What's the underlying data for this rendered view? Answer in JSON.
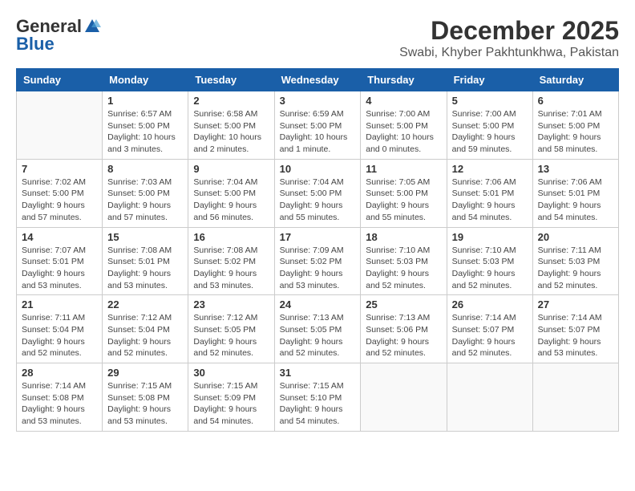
{
  "header": {
    "logo_general": "General",
    "logo_blue": "Blue",
    "month_year": "December 2025",
    "location": "Swabi, Khyber Pakhtunkhwa, Pakistan"
  },
  "weekdays": [
    "Sunday",
    "Monday",
    "Tuesday",
    "Wednesday",
    "Thursday",
    "Friday",
    "Saturday"
  ],
  "weeks": [
    [
      {
        "day": "",
        "info": ""
      },
      {
        "day": "1",
        "info": "Sunrise: 6:57 AM\nSunset: 5:00 PM\nDaylight: 10 hours\nand 3 minutes."
      },
      {
        "day": "2",
        "info": "Sunrise: 6:58 AM\nSunset: 5:00 PM\nDaylight: 10 hours\nand 2 minutes."
      },
      {
        "day": "3",
        "info": "Sunrise: 6:59 AM\nSunset: 5:00 PM\nDaylight: 10 hours\nand 1 minute."
      },
      {
        "day": "4",
        "info": "Sunrise: 7:00 AM\nSunset: 5:00 PM\nDaylight: 10 hours\nand 0 minutes."
      },
      {
        "day": "5",
        "info": "Sunrise: 7:00 AM\nSunset: 5:00 PM\nDaylight: 9 hours\nand 59 minutes."
      },
      {
        "day": "6",
        "info": "Sunrise: 7:01 AM\nSunset: 5:00 PM\nDaylight: 9 hours\nand 58 minutes."
      }
    ],
    [
      {
        "day": "7",
        "info": "Sunrise: 7:02 AM\nSunset: 5:00 PM\nDaylight: 9 hours\nand 57 minutes."
      },
      {
        "day": "8",
        "info": "Sunrise: 7:03 AM\nSunset: 5:00 PM\nDaylight: 9 hours\nand 57 minutes."
      },
      {
        "day": "9",
        "info": "Sunrise: 7:04 AM\nSunset: 5:00 PM\nDaylight: 9 hours\nand 56 minutes."
      },
      {
        "day": "10",
        "info": "Sunrise: 7:04 AM\nSunset: 5:00 PM\nDaylight: 9 hours\nand 55 minutes."
      },
      {
        "day": "11",
        "info": "Sunrise: 7:05 AM\nSunset: 5:00 PM\nDaylight: 9 hours\nand 55 minutes."
      },
      {
        "day": "12",
        "info": "Sunrise: 7:06 AM\nSunset: 5:01 PM\nDaylight: 9 hours\nand 54 minutes."
      },
      {
        "day": "13",
        "info": "Sunrise: 7:06 AM\nSunset: 5:01 PM\nDaylight: 9 hours\nand 54 minutes."
      }
    ],
    [
      {
        "day": "14",
        "info": "Sunrise: 7:07 AM\nSunset: 5:01 PM\nDaylight: 9 hours\nand 53 minutes."
      },
      {
        "day": "15",
        "info": "Sunrise: 7:08 AM\nSunset: 5:01 PM\nDaylight: 9 hours\nand 53 minutes."
      },
      {
        "day": "16",
        "info": "Sunrise: 7:08 AM\nSunset: 5:02 PM\nDaylight: 9 hours\nand 53 minutes."
      },
      {
        "day": "17",
        "info": "Sunrise: 7:09 AM\nSunset: 5:02 PM\nDaylight: 9 hours\nand 53 minutes."
      },
      {
        "day": "18",
        "info": "Sunrise: 7:10 AM\nSunset: 5:03 PM\nDaylight: 9 hours\nand 52 minutes."
      },
      {
        "day": "19",
        "info": "Sunrise: 7:10 AM\nSunset: 5:03 PM\nDaylight: 9 hours\nand 52 minutes."
      },
      {
        "day": "20",
        "info": "Sunrise: 7:11 AM\nSunset: 5:03 PM\nDaylight: 9 hours\nand 52 minutes."
      }
    ],
    [
      {
        "day": "21",
        "info": "Sunrise: 7:11 AM\nSunset: 5:04 PM\nDaylight: 9 hours\nand 52 minutes."
      },
      {
        "day": "22",
        "info": "Sunrise: 7:12 AM\nSunset: 5:04 PM\nDaylight: 9 hours\nand 52 minutes."
      },
      {
        "day": "23",
        "info": "Sunrise: 7:12 AM\nSunset: 5:05 PM\nDaylight: 9 hours\nand 52 minutes."
      },
      {
        "day": "24",
        "info": "Sunrise: 7:13 AM\nSunset: 5:05 PM\nDaylight: 9 hours\nand 52 minutes."
      },
      {
        "day": "25",
        "info": "Sunrise: 7:13 AM\nSunset: 5:06 PM\nDaylight: 9 hours\nand 52 minutes."
      },
      {
        "day": "26",
        "info": "Sunrise: 7:14 AM\nSunset: 5:07 PM\nDaylight: 9 hours\nand 52 minutes."
      },
      {
        "day": "27",
        "info": "Sunrise: 7:14 AM\nSunset: 5:07 PM\nDaylight: 9 hours\nand 53 minutes."
      }
    ],
    [
      {
        "day": "28",
        "info": "Sunrise: 7:14 AM\nSunset: 5:08 PM\nDaylight: 9 hours\nand 53 minutes."
      },
      {
        "day": "29",
        "info": "Sunrise: 7:15 AM\nSunset: 5:08 PM\nDaylight: 9 hours\nand 53 minutes."
      },
      {
        "day": "30",
        "info": "Sunrise: 7:15 AM\nSunset: 5:09 PM\nDaylight: 9 hours\nand 54 minutes."
      },
      {
        "day": "31",
        "info": "Sunrise: 7:15 AM\nSunset: 5:10 PM\nDaylight: 9 hours\nand 54 minutes."
      },
      {
        "day": "",
        "info": ""
      },
      {
        "day": "",
        "info": ""
      },
      {
        "day": "",
        "info": ""
      }
    ]
  ]
}
